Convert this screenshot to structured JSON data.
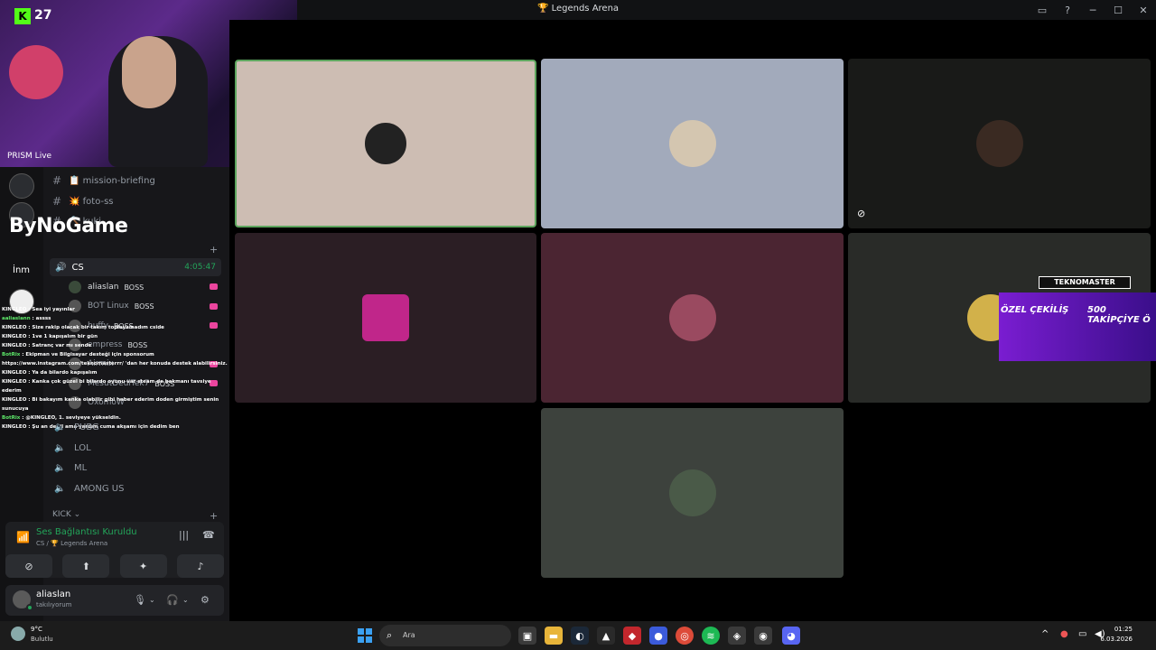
{
  "window": {
    "title": "🏆 Legends Arena",
    "icons": [
      "inbox-icon",
      "help-icon",
      "minimize-icon",
      "maximize-icon",
      "close-icon"
    ],
    "icon_glyphs": [
      "▭",
      "?",
      "─",
      "☐",
      "✕"
    ]
  },
  "overlay": {
    "kick_count": "27",
    "kick_letter": "K",
    "prism_label": "PRISM Live",
    "brand": "ByNoGame",
    "rail_label": "İnm"
  },
  "channels": {
    "text": [
      {
        "name": "📋 mission-briefing"
      },
      {
        "name": "💥 foto-ss"
      },
      {
        "name": "🔨 kuki"
      }
    ],
    "active_voice": {
      "name": "CS",
      "time": "4:05:47"
    },
    "members": [
      {
        "name": "aliaslan",
        "role": "BOSS"
      },
      {
        "name": "BOT Linux",
        "role": "BOSS"
      },
      {
        "name": "buffy",
        "role": "BOSS"
      },
      {
        "name": "empress",
        "role": "BOSS"
      },
      {
        "name": "Airmix",
        "role": ""
      },
      {
        "name": "MesutDediTek7",
        "role": "BOSS"
      },
      {
        "name": "OxomoW",
        "role": ""
      }
    ],
    "voice": [
      {
        "name": "PUBG"
      },
      {
        "name": "LOL"
      },
      {
        "name": "ML"
      },
      {
        "name": "AMONG US"
      }
    ],
    "category": "KICK ⌄"
  },
  "chat": [
    {
      "user": "KINGLEO",
      "msg": "Sea iyi yayınlar"
    },
    {
      "user": "aaliaslann",
      "msg": "assss"
    },
    {
      "user": "KINGLEO",
      "msg": "Size rakip olacak bir takım toplayamadım cside"
    },
    {
      "user": "KINGLEO",
      "msg": "1ve 1 kapışalım bir gün"
    },
    {
      "user": "KINGLEO",
      "msg": "Satranç var mı sende"
    },
    {
      "user": "BotRix",
      "msg": "Ekipman ve Bilgisayar desteği için sponsorum https://www.instagram.com/teknomasterrr/ 'dan her konuda destek alabilirsiniz."
    },
    {
      "user": "KINGLEO",
      "msg": "Ya da bilardo kapışalım"
    },
    {
      "user": "KINGLEO",
      "msg": "Kanka çok güzel bi bilardo oyunu var steam de bakmanı tavsiye ederim"
    },
    {
      "user": "KINGLEO",
      "msg": "Bi bakayım kanka olabilir gibi haber ederim doden girmiştim senin sunucuya"
    },
    {
      "user": "BotRix",
      "msg": "@KINGLEO, 1. seviyeye yükseldin."
    },
    {
      "user": "KINGLEO",
      "msg": "Şu an değil ama yardım cuma akşamı için dedim ben"
    }
  ],
  "voice_panel": {
    "status": "Ses Bağlantısı Kuruldu",
    "location": "CS / 🏆 Legends Arena",
    "buttons": [
      {
        "icon": "camera-off-icon",
        "glyph": "⊘"
      },
      {
        "icon": "screen-share-icon",
        "glyph": "⬆"
      },
      {
        "icon": "activity-icon",
        "glyph": "✦"
      },
      {
        "icon": "soundboard-icon",
        "glyph": "♪"
      }
    ]
  },
  "user_panel": {
    "name": "aliaslan",
    "status": "takılıyorum"
  },
  "promo": {
    "brand": "TEKNOMASTER",
    "line1": "ÖZEL ÇEKİLİŞ",
    "line2": "500 TAKİPÇİYE Ö"
  },
  "tiles": [
    {
      "color": "#cdbdb3",
      "avatar_color": "#222"
    },
    {
      "color": "#a2aabb",
      "avatar_color": "#d4c6b0"
    },
    {
      "color": "#191a18",
      "avatar_color": "#3a2a22"
    },
    {
      "color": "#2b1e24",
      "avatar_color": "#c0268a"
    },
    {
      "color": "#4b2532",
      "avatar_color": "#9a4a60"
    },
    {
      "color": "#292b28",
      "avatar_color": "#d2b14a"
    },
    {
      "color": "#3d423d",
      "avatar_color": "#4a5a48"
    }
  ],
  "taskbar": {
    "weather_temp": "9°C",
    "weather_desc": "Bulutlu",
    "search_placeholder": "Ara",
    "clock_time": "01:25",
    "clock_date": "6.03.2026"
  },
  "colors": {
    "accent_green": "#23a55a",
    "boss_pink": "#eb459e",
    "kick_green": "#53fc18"
  }
}
